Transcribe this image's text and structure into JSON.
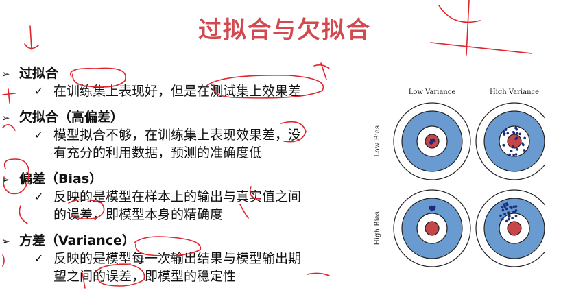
{
  "slide": {
    "title": "过拟合与欠拟合",
    "bullets": [
      {
        "marker": "➢",
        "heading": "过拟合",
        "sub_marker": "✓",
        "lines": [
          "在训练集上表现好，但是在测试集上效果差"
        ]
      },
      {
        "marker": "➢",
        "heading": "欠拟合（高偏差）",
        "sub_marker": "✓",
        "lines": [
          "模型拟合不够，在训练集上表现效果差，没",
          "有充分的利用数据，预测的准确度低"
        ]
      },
      {
        "marker": "➢",
        "heading": "偏差（Bias）",
        "sub_marker": "✓",
        "lines": [
          "反映的是模型在样本上的输出与真实值之间",
          "的误差，即模型本身的精确度"
        ]
      },
      {
        "marker": "➢",
        "heading": "方差（Variance）",
        "sub_marker": "✓",
        "lines": [
          "反映的是模型每一次输出结果与模型输出期",
          "望之间的误差，即模型的稳定性"
        ]
      }
    ]
  },
  "figure": {
    "col_labels": [
      "Low Variance",
      "High Variance"
    ],
    "row_labels": [
      "Low Bias",
      "High Bias"
    ],
    "colors": {
      "title": "#d24a4f",
      "ring_blue": "#6a9bd0",
      "bullseye_red": "#c4454a",
      "dot_navy": "#1b2a7a",
      "ink_red": "#e0242b"
    }
  }
}
